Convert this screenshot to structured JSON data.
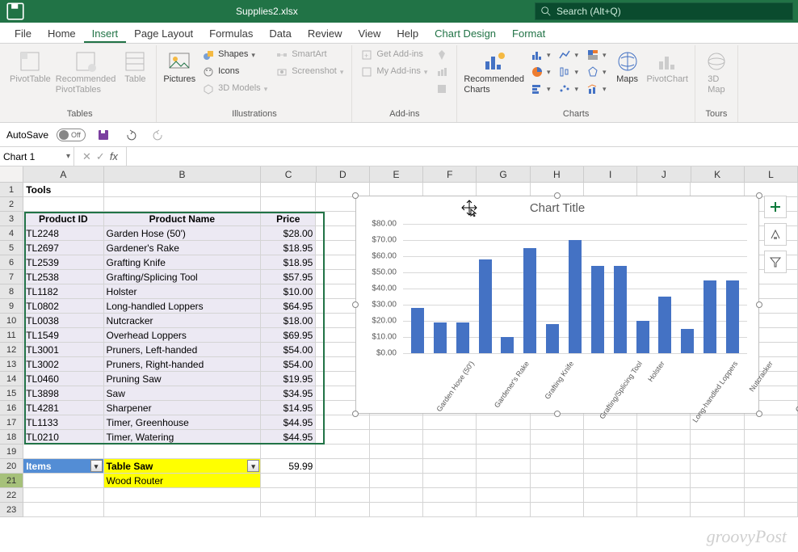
{
  "titlebar": {
    "filename": "Supplies2.xlsx",
    "search_placeholder": "Search (Alt+Q)"
  },
  "tabs": {
    "file": "File",
    "home": "Home",
    "insert": "Insert",
    "page_layout": "Page Layout",
    "formulas": "Formulas",
    "data": "Data",
    "review": "Review",
    "view": "View",
    "help": "Help",
    "chart_design": "Chart Design",
    "format": "Format"
  },
  "ribbon": {
    "tables": {
      "label": "Tables",
      "pivottable": "PivotTable",
      "rec_pivot": "Recommended\nPivotTables",
      "table": "Table"
    },
    "illus": {
      "label": "Illustrations",
      "pictures": "Pictures",
      "shapes": "Shapes",
      "icons": "Icons",
      "models": "3D Models",
      "smartart": "SmartArt",
      "screenshot": "Screenshot"
    },
    "addins": {
      "label": "Add-ins",
      "get": "Get Add-ins",
      "my": "My Add-ins"
    },
    "charts": {
      "label": "Charts",
      "rec": "Recommended\nCharts",
      "maps": "Maps",
      "pivotchart": "PivotChart"
    },
    "tours": {
      "label": "Tours",
      "map3d": "3D\nMap"
    }
  },
  "qat": {
    "autosave_label": "AutoSave",
    "autosave_state": "Off"
  },
  "namebox": "Chart 1",
  "cols": [
    "A",
    "B",
    "C",
    "D",
    "E",
    "F",
    "G",
    "H",
    "I",
    "J",
    "K",
    "L"
  ],
  "col_widths": {
    "A": 102,
    "B": 200,
    "C": 70,
    "rest": 68
  },
  "sheet": {
    "title": "Tools",
    "headers": {
      "a": "Product ID",
      "b": "Product Name",
      "c": "Price"
    },
    "rows": [
      {
        "n": 4,
        "a": "TL2248",
        "b": "Garden Hose (50')",
        "c": "$28.00"
      },
      {
        "n": 5,
        "a": "TL2697",
        "b": "Gardener's Rake",
        "c": "$18.95"
      },
      {
        "n": 6,
        "a": "TL2539",
        "b": "Grafting Knife",
        "c": "$18.95"
      },
      {
        "n": 7,
        "a": "TL2538",
        "b": "Grafting/Splicing Tool",
        "c": "$57.95"
      },
      {
        "n": 8,
        "a": "TL1182",
        "b": "Holster",
        "c": "$10.00"
      },
      {
        "n": 9,
        "a": "TL0802",
        "b": "Long-handled Loppers",
        "c": "$64.95"
      },
      {
        "n": 10,
        "a": "TL0038",
        "b": "Nutcracker",
        "c": "$18.00"
      },
      {
        "n": 11,
        "a": "TL1549",
        "b": "Overhead Loppers",
        "c": "$69.95"
      },
      {
        "n": 12,
        "a": "TL3001",
        "b": "Pruners, Left-handed",
        "c": "$54.00"
      },
      {
        "n": 13,
        "a": "TL3002",
        "b": "Pruners, Right-handed",
        "c": "$54.00"
      },
      {
        "n": 14,
        "a": "TL0460",
        "b": "Pruning Saw",
        "c": "$19.95"
      },
      {
        "n": 15,
        "a": "TL3898",
        "b": "Saw",
        "c": "$34.95"
      },
      {
        "n": 16,
        "a": "TL4281",
        "b": "Sharpener",
        "c": "$14.95"
      },
      {
        "n": 17,
        "a": "TL1133",
        "b": "Timer, Greenhouse",
        "c": "$44.95"
      },
      {
        "n": 18,
        "a": "TL0210",
        "b": "Timer, Watering",
        "c": "$44.95"
      }
    ],
    "row20": {
      "a": "Items",
      "b": "Table Saw",
      "c": "59.99"
    },
    "row21": {
      "b": "Wood Router"
    }
  },
  "chart_data": {
    "type": "bar",
    "title": "Chart Title",
    "ylabel": "",
    "xlabel": "",
    "ylim": [
      0,
      80
    ],
    "yticks": [
      "$0.00",
      "$10.00",
      "$20.00",
      "$30.00",
      "$40.00",
      "$50.00",
      "$60.00",
      "$70.00",
      "$80.00"
    ],
    "categories": [
      "Garden Hose (50')",
      "Gardener's Rake",
      "Grafting Knife",
      "Grafting/Splicing Tool",
      "Holster",
      "Long-handled Loppers",
      "Nutcracker",
      "Overhead Loppers",
      "Pruners, Left-handed",
      "Pruners, Right-handed",
      "Pruning Saw",
      "Saw",
      "Sharpener",
      "Timer, Greenhouse",
      "Timer, Watering"
    ],
    "values": [
      28.0,
      18.95,
      18.95,
      57.95,
      10.0,
      64.95,
      18.0,
      69.95,
      54.0,
      54.0,
      19.95,
      34.95,
      14.95,
      44.95,
      44.95
    ]
  },
  "watermark": "groovyPost"
}
